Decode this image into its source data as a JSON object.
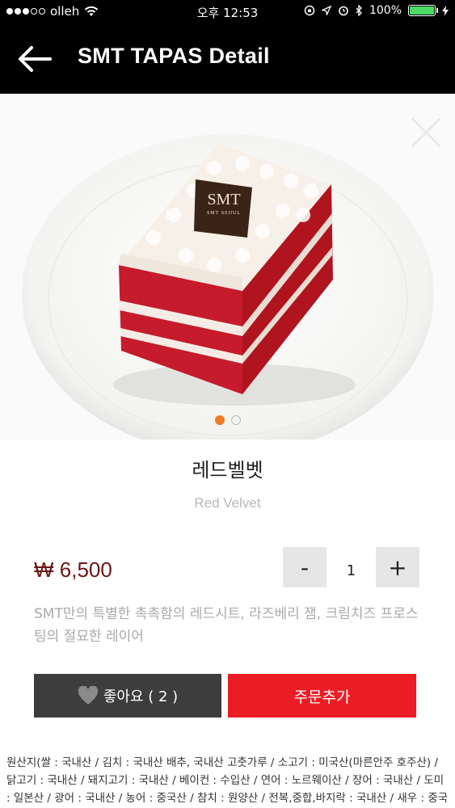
{
  "status_bar": {
    "carrier": "olleh",
    "time": "오후 12:53",
    "battery": "100%",
    "battery_level": 1.0
  },
  "header": {
    "title": "SMT TAPAS Detail",
    "back_icon": "arrow-left-icon"
  },
  "product": {
    "image_logo": "SMT",
    "image_logo_sub": "SMT SEOUL",
    "name_ko": "레드벨벳",
    "name_en": "Red Velvet",
    "price": "₩ 6,500",
    "quantity": "1",
    "qty_minus": "-",
    "qty_plus": "+",
    "description": "SMT만의 특별한 촉촉함의 레드시트, 라즈베리 잼, 크림치즈 프로스팅의 절묘한 레이어",
    "image_count": 2,
    "image_index": 0
  },
  "actions": {
    "like_label": "좋아요 ( 2 )",
    "order_label": "주문추가"
  },
  "origin_info": "원산지(쌀 : 국내산 / 김치 : 국내산 배추, 국내산 고춧가루 / 소고기 : 미국산(마른안주 호주산) / 닭고기 : 국내산 / 돼지고기 : 국내산 / 베이컨 : 수입산 / 연어 : 노르웨이산 / 장어 : 국내산 / 도미 : 일본산 / 광어 : 국내산 / 농어 : 중국산 / 참치 : 원양산 / 전복,중합,바지락 : 국내산 / 새우 : 중국",
  "colors": {
    "header_bg": "#000000",
    "price": "#6b1616",
    "order_button": "#ec1c24",
    "like_button": "#3d3d3d",
    "pager_active": "#f07b22"
  }
}
